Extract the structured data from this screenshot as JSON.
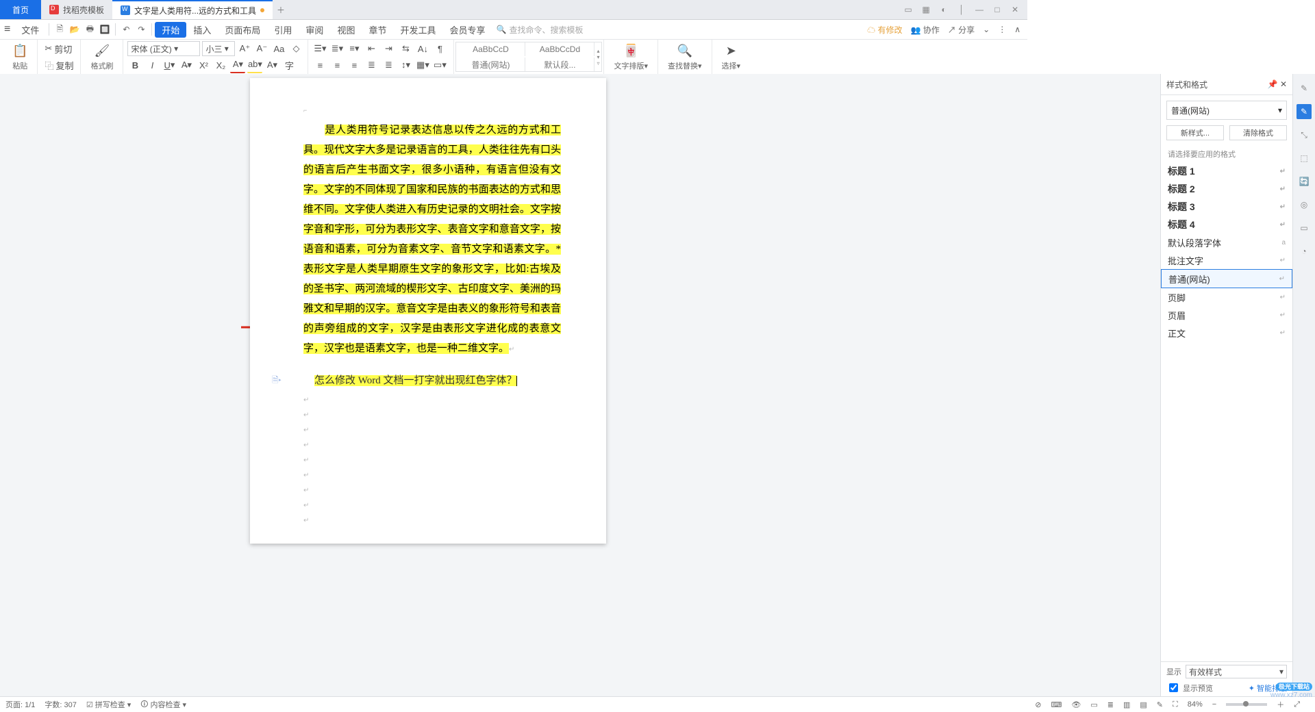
{
  "tabs": {
    "home": "首页",
    "skin": "找稻壳模板",
    "doc": "文字是人类用符...远的方式和工具"
  },
  "menu": {
    "file": "文件",
    "items": [
      "开始",
      "插入",
      "页面布局",
      "引用",
      "审阅",
      "视图",
      "章节",
      "开发工具",
      "会员专享"
    ],
    "search_ph": "查找命令、搜索模板"
  },
  "titleright": {
    "track": "有修改",
    "coop": "协作",
    "share": "分享"
  },
  "clipboard": {
    "paste": "粘贴",
    "cut": "剪切",
    "copy": "复制",
    "brush": "格式刷"
  },
  "font": {
    "name": "宋体 (正文)",
    "size": "小三"
  },
  "styles_prev": {
    "a": "AaBbCcD",
    "b": "AaBbCcDd",
    "c": "普通(网站)",
    "d": "默认段..."
  },
  "biggroups": {
    "layout": "文字排版",
    "find": "查找替换",
    "select": "选择"
  },
  "panel": {
    "title": "样式和格式",
    "current": "普通(网站)",
    "new": "新样式...",
    "clear": "清除格式",
    "hint": "请选择要应用的格式",
    "items": [
      {
        "label": "标题 1",
        "h": true
      },
      {
        "label": "标题 2",
        "h": true
      },
      {
        "label": "标题 3",
        "h": true
      },
      {
        "label": "标题 4",
        "h": true
      },
      {
        "label": "默认段落字体",
        "mark": "a"
      },
      {
        "label": "批注文字"
      },
      {
        "label": "普通(网站)",
        "sel": true
      },
      {
        "label": "页脚"
      },
      {
        "label": "页眉"
      },
      {
        "label": "正文"
      }
    ],
    "show": "显示",
    "show_val": "有效样式",
    "preview": "显示预览",
    "smart": "智能排版"
  },
  "doc": {
    "p1": "是人类用符号记录表达信息以传之久远的方式和工具。现代文字大多是记录语言的工具，人类往往先有口头的语言后产生书面文字，很多小语种，有语言但没有文字。文字的不同体现了国家和民族的书面表达的方式和思维不同。文字使人类进入有历史记录的文明社会。文字按字音和字形，可分为表形文字、表音文字和意音文字，按语音和语素，可分为音素文字、音节文字和语素文字。*表形文字是人类早期原生文字的象形文字，比如:古埃及的圣书字、两河流域的楔形文字、古印度文字、美洲的玛雅文和早期的汉字。意音文字是由表义的象形符号和表音的声旁组成的文字，汉字是由表形文字进化成的表意文字，汉字也是语素文字，也是一种二维文字。",
    "p2": "怎么修改 Word 文档一打字就出现红色字体？"
  },
  "status": {
    "page": "页面: 1/1",
    "words": "字数: 307",
    "spell": "拼写检查",
    "content": "内容检查",
    "zoom": "84%"
  },
  "watermark": {
    "brand": "极光下载站",
    "url": "www.xz7.com"
  }
}
